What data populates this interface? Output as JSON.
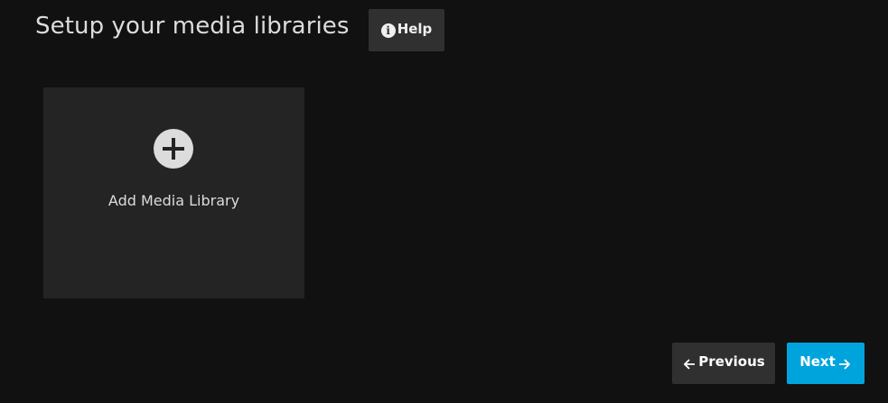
{
  "header": {
    "title": "Setup your media libraries",
    "help_label": "Help",
    "help_icon": "info-icon"
  },
  "library": {
    "add_label": "Add Media Library",
    "add_icon": "plus-circle-icon"
  },
  "footer": {
    "previous_label": "Previous",
    "previous_icon": "arrow-left-icon",
    "next_label": "Next",
    "next_icon": "arrow-right-icon"
  },
  "colors": {
    "background": "#111111",
    "card": "#242424",
    "button": "#303030",
    "accent": "#00a4dc"
  }
}
